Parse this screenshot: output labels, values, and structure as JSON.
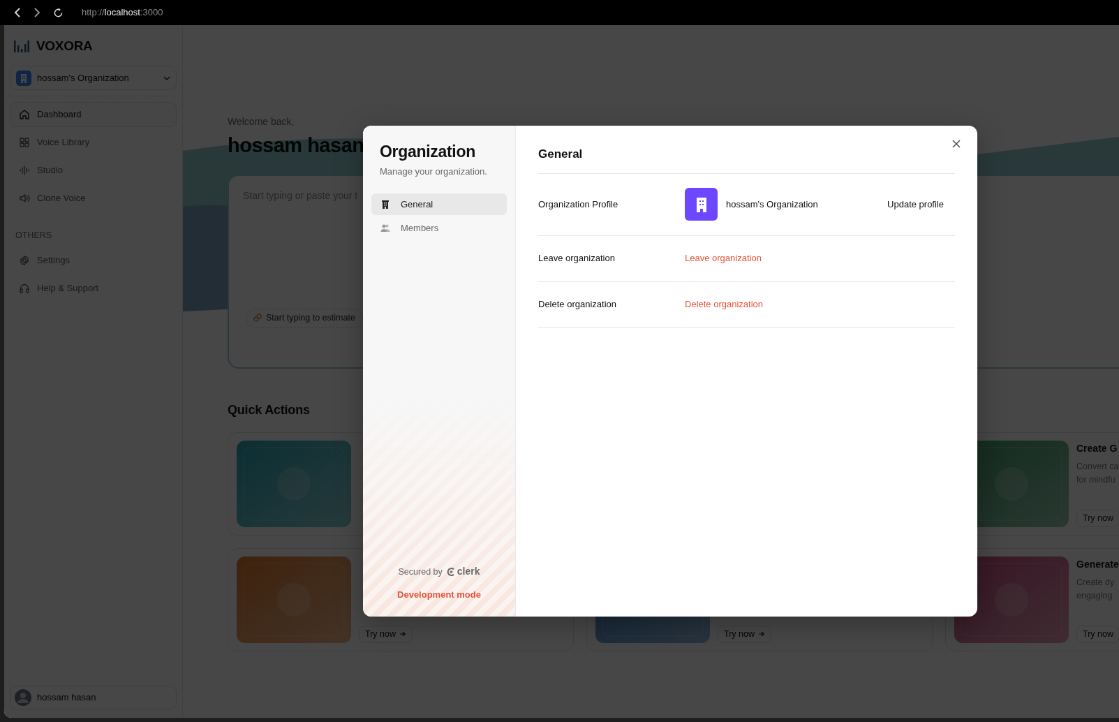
{
  "browser": {
    "url": {
      "scheme": "http://",
      "host": "localhost",
      "port": ":3000"
    }
  },
  "sidebar": {
    "brand": "VOXORA",
    "org_switcher": {
      "name": "hossam's Organization"
    },
    "nav": [
      {
        "label": "Dashboard",
        "selected": true
      },
      {
        "label": "Voice Library",
        "selected": false
      },
      {
        "label": "Studio",
        "selected": false
      },
      {
        "label": "Clone Voice",
        "selected": false
      }
    ],
    "section_title": "OTHERS",
    "others": [
      {
        "label": "Settings"
      },
      {
        "label": "Help & Support"
      }
    ],
    "user": {
      "name": "hossam hasan"
    }
  },
  "main": {
    "greeting": "Welcome back,",
    "user_name": "hossam hasan",
    "editor": {
      "placeholder": "Start typing or paste your t",
      "estimate": "Start typing to estimate"
    },
    "quick_actions": {
      "title": "Quick Actions",
      "rows": [
        {
          "cards": [
            {
              "kind": "card"
            },
            {
              "kind": "covered"
            },
            {
              "kind": "card",
              "title": "Create G",
              "description": [
                "Convert ca",
                "for mindfu"
              ],
              "cta": "Try now"
            }
          ]
        },
        {
          "cards": [
            {
              "kind": "card",
              "cta": "Try now"
            },
            {
              "kind": "card",
              "cta": "Try now"
            },
            {
              "kind": "card",
              "title": "Generate",
              "description": [
                "Create dy",
                "engaging"
              ],
              "cta": "Try now"
            }
          ]
        }
      ]
    }
  },
  "dialog": {
    "title": "Organization",
    "subtitle": "Manage your organization.",
    "nav": [
      {
        "label": "General",
        "selected": true
      },
      {
        "label": "Members",
        "selected": false
      }
    ],
    "footer": {
      "secured_by": "Secured by",
      "brand": "clerk",
      "mode": "Development mode"
    },
    "section_title": "General",
    "rows": [
      {
        "kind": "profile",
        "label": "Organization Profile",
        "org_name": "hossam's Organization",
        "action": "Update profile"
      },
      {
        "kind": "danger",
        "label": "Leave organization",
        "action": "Leave organization"
      },
      {
        "kind": "danger",
        "label": "Delete organization",
        "action": "Delete organization"
      }
    ]
  }
}
